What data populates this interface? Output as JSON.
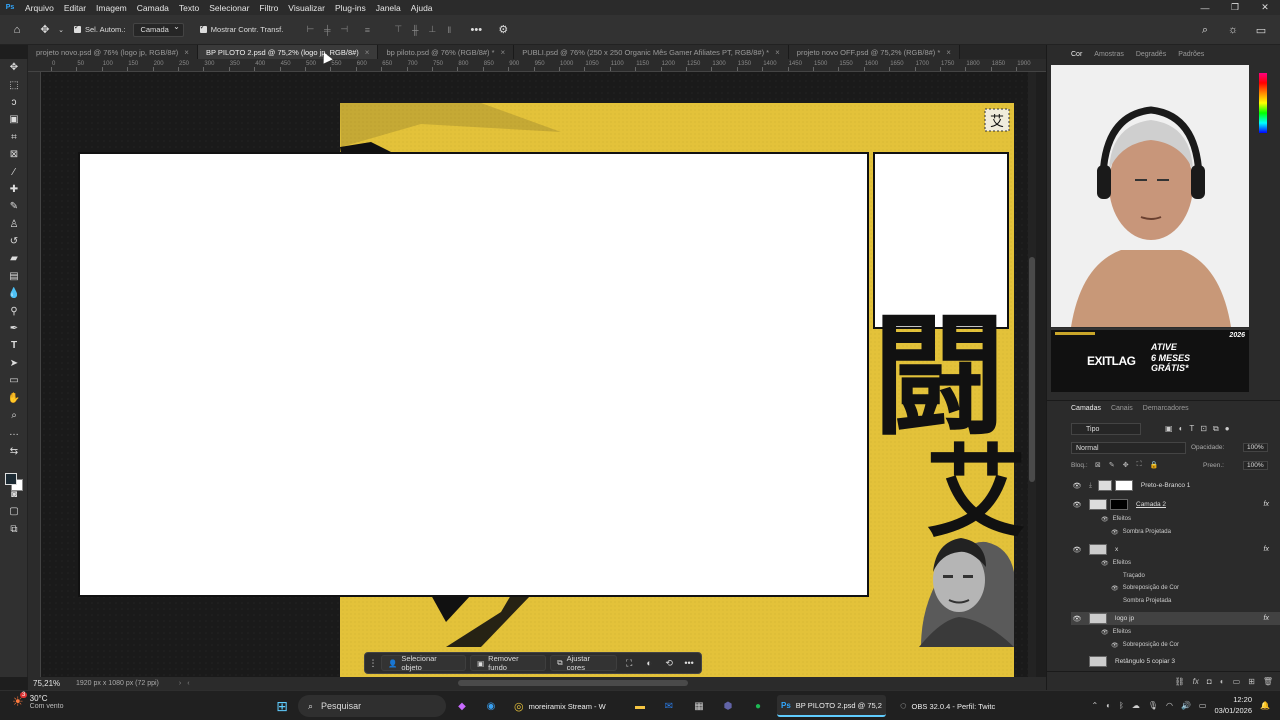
{
  "menubar": {
    "logo": "Ps",
    "items": [
      "Arquivo",
      "Editar",
      "Imagem",
      "Camada",
      "Texto",
      "Selecionar",
      "Filtro",
      "Visualizar",
      "Plug-ins",
      "Janela",
      "Ajuda"
    ]
  },
  "optbar": {
    "auto_select_label": "Sel. Autom.:",
    "auto_select_value": "Camada",
    "show_transform_label": "Mostrar Contr. Transf."
  },
  "tabs": [
    {
      "label": "projeto novo.psd @ 76% (logo jp, RGB/8#)",
      "active": false
    },
    {
      "label": "BP PILOTO 2.psd @ 75,2% (logo jp, RGB/8#)",
      "active": true
    },
    {
      "label": "bp piloto.psd @ 76% (RGB/8#) *",
      "active": false
    },
    {
      "label": "PUBLI.psd @ 76% (250 x 250 Organic Mês Gamer Afiliates PT, RGB/8#) *",
      "active": false
    },
    {
      "label": "projeto novo OFF.psd @ 75,2% (RGB/8#) *",
      "active": false
    }
  ],
  "ruler": [
    "0",
    "50",
    "100",
    "150",
    "200",
    "250",
    "300",
    "350",
    "400",
    "450",
    "500",
    "550",
    "600",
    "650",
    "700",
    "750",
    "800",
    "850",
    "900",
    "950",
    "1000",
    "1050",
    "1100",
    "1150",
    "1200",
    "1250",
    "1300",
    "1350",
    "1400",
    "1450",
    "1500",
    "1550",
    "1600",
    "1650",
    "1700",
    "1750",
    "1800",
    "1850",
    "1900"
  ],
  "canvas": {
    "yellow": "#e3c23a",
    "kanji": "闘",
    "kanji2": "艾"
  },
  "status": {
    "zoom": "75,21%",
    "dims": "1920 px x 1080 px (72 ppi)"
  },
  "ctxbar": {
    "select_object": "Selecionar objeto",
    "remove_bg": "Remover fundo",
    "adjust_colors": "Ajustar cores"
  },
  "right_panel": {
    "tabs": [
      "Cor",
      "Amostras",
      "Degradês",
      "Padrões"
    ],
    "ad_brand": "EXITLAG",
    "ad_line1": "ATIVE",
    "ad_line2": "6 MESES",
    "ad_line3": "GRÁTIS*",
    "ad_year": "2026"
  },
  "layers_panel": {
    "tabs": [
      "Camadas",
      "Canais",
      "Demarcadores"
    ],
    "filter": "Tipo",
    "blend_mode": "Normal",
    "opacity_label": "Opacidade:",
    "opacity_value": "100%",
    "lock_label": "Bloq.:",
    "fill_label": "Preen.:",
    "fill_value": "100%",
    "layers": [
      {
        "name": "Preto-e-Branco 1"
      },
      {
        "name": "Camada 2"
      },
      {
        "name": "Efeitos"
      },
      {
        "name": "Sombra Projetada"
      },
      {
        "name": "x"
      },
      {
        "name": "Efeitos"
      },
      {
        "name": "Traçado"
      },
      {
        "name": "Sobreposição de Cor"
      },
      {
        "name": "Sombra Projetada"
      },
      {
        "name": "logo jp"
      },
      {
        "name": "Efeitos"
      },
      {
        "name": "Sobreposição de Cor"
      },
      {
        "name": "Retângulo 5 copiar 3"
      }
    ]
  },
  "taskbar": {
    "temp": "30°C",
    "condition": "Com vento",
    "weather_badge": "3",
    "search": "Pesquisar",
    "apps": [
      {
        "label": "moreiramix Stream - W"
      },
      {
        "label": "BP PILOTO 2.psd @ 75,2"
      },
      {
        "label": "OBS 32.0.4 - Perfil: Twitc"
      }
    ],
    "time": "12:20",
    "date": "03/01/2026"
  }
}
